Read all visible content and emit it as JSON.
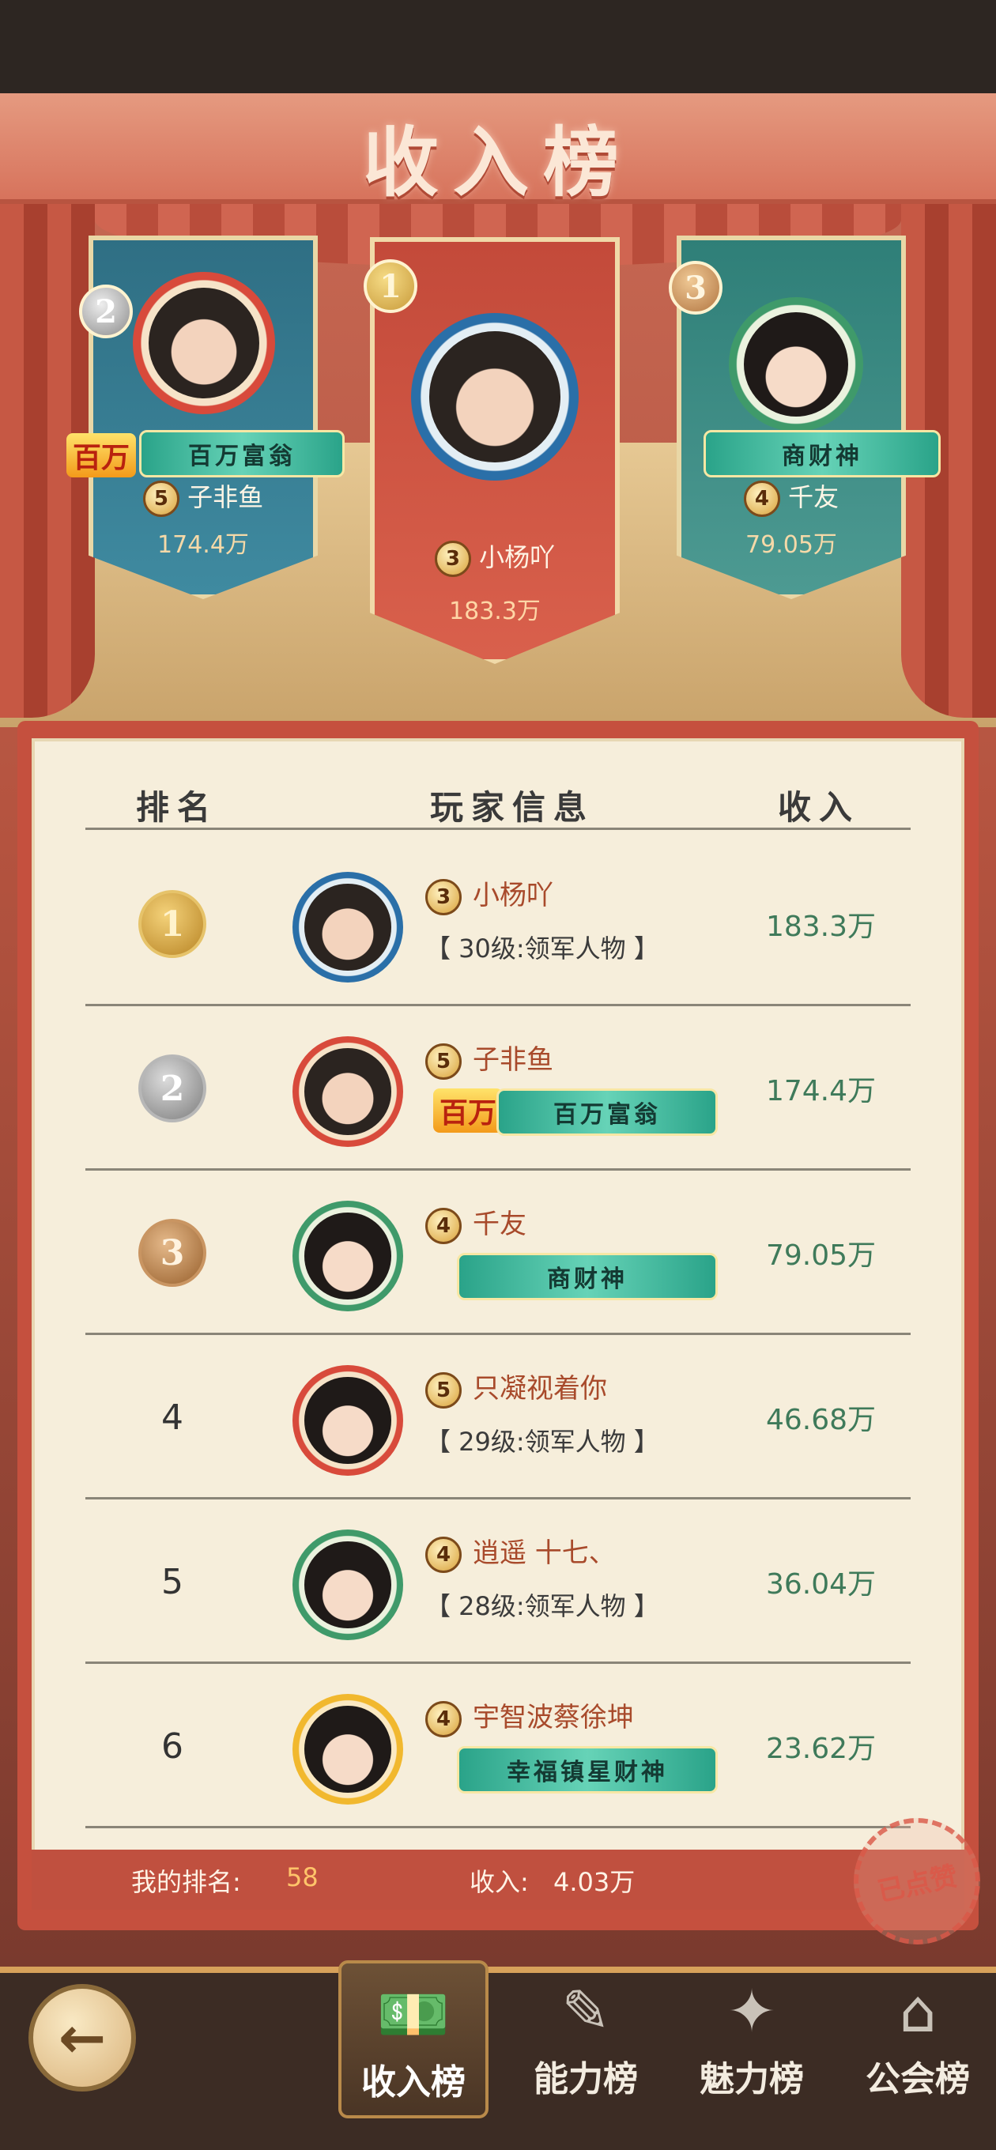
{
  "title": "收入榜",
  "podium": [
    {
      "rank": "2",
      "name": "子非鱼",
      "vip": "5",
      "value": "174.4万",
      "badge_icon": "百万",
      "badge": "百万富翁"
    },
    {
      "rank": "1",
      "name": "小杨吖",
      "vip": "3",
      "value": "183.3万"
    },
    {
      "rank": "3",
      "name": "千友",
      "vip": "4",
      "value": "79.05万",
      "badge": "商财神"
    }
  ],
  "table": {
    "headers": {
      "rank": "排名",
      "player": "玩家信息",
      "income": "收入"
    },
    "rows": [
      {
        "rank": "1",
        "name": "小杨吖",
        "vip": "3",
        "sub": "【 30级:领军人物 】",
        "income": "183.3万"
      },
      {
        "rank": "2",
        "name": "子非鱼",
        "vip": "5",
        "badge_icon": "百万",
        "badge": "百万富翁",
        "income": "174.4万"
      },
      {
        "rank": "3",
        "name": "千友",
        "vip": "4",
        "badge": "商财神",
        "income": "79.05万"
      },
      {
        "rank": "4",
        "name": "只凝视着你",
        "vip": "5",
        "sub": "【 29级:领军人物 】",
        "income": "46.68万"
      },
      {
        "rank": "5",
        "name": "逍遥 十七、",
        "vip": "4",
        "sub": "【 28级:领军人物 】",
        "income": "36.04万"
      },
      {
        "rank": "6",
        "name": "宇智波蔡徐坤",
        "vip": "4",
        "badge": "幸福镇星财神",
        "income": "23.62万"
      }
    ]
  },
  "my": {
    "rank_label": "我的排名:",
    "rank": "58",
    "income_label": "收入:",
    "income": "4.03万"
  },
  "stamp": "已点赞",
  "nav": {
    "back_icon": "arrow-left-icon",
    "tabs": [
      {
        "label": "收入榜",
        "icon": "money-icon",
        "active": true
      },
      {
        "label": "能力榜",
        "icon": "clipboard-icon",
        "active": false
      },
      {
        "label": "魅力榜",
        "icon": "sparkle-icon",
        "active": false
      },
      {
        "label": "公会榜",
        "icon": "building-icon",
        "active": false
      }
    ]
  },
  "colors": {
    "panel_red": "#c5503e",
    "paper": "#f6eedb",
    "income_green": "#3f7a5a",
    "name_brown": "#a84a2b"
  }
}
